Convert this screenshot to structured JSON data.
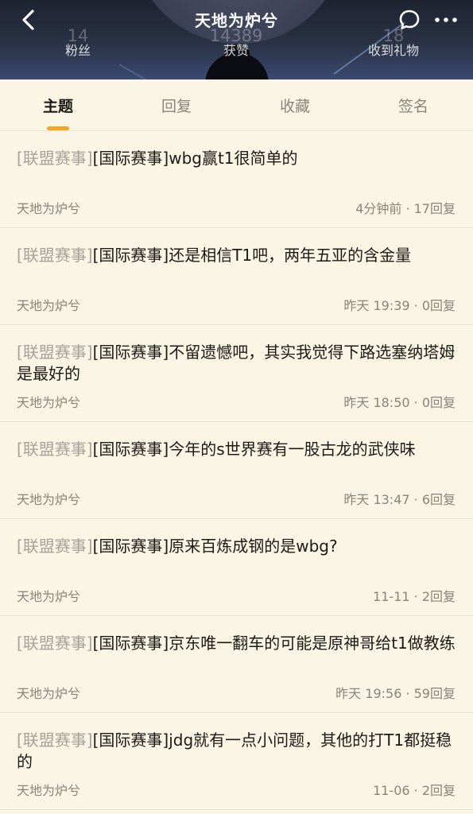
{
  "header": {
    "title": "天地为炉兮",
    "stats": [
      {
        "value": "14",
        "label": "粉丝"
      },
      {
        "value": "14389",
        "label": "获赞"
      },
      {
        "value": "18",
        "label": "收到礼物"
      }
    ]
  },
  "tabs": [
    {
      "label": "主题",
      "active": true
    },
    {
      "label": "回复",
      "active": false
    },
    {
      "label": "收藏",
      "active": false
    },
    {
      "label": "签名",
      "active": false
    }
  ],
  "posts": [
    {
      "tag": "[联盟赛事]",
      "title": "[国际赛事]wbg赢t1很简单的",
      "author": "天地为炉兮",
      "meta": "4分钟前 · 17回复"
    },
    {
      "tag": "[联盟赛事]",
      "title": "[国际赛事]还是相信T1吧，两年五亚的含金量",
      "author": "天地为炉兮",
      "meta": "昨天 19:39 · 0回复"
    },
    {
      "tag": "[联盟赛事]",
      "title": "[国际赛事]不留遗憾吧，其实我觉得下路选塞纳塔姆是最好的",
      "author": "天地为炉兮",
      "meta": "昨天 18:50 · 0回复"
    },
    {
      "tag": "[联盟赛事]",
      "title": "[国际赛事]今年的s世界赛有一股古龙的武侠味",
      "author": "天地为炉兮",
      "meta": "昨天 13:47 · 6回复"
    },
    {
      "tag": "[联盟赛事]",
      "title": "[国际赛事]原来百炼成钢的是wbg?",
      "author": "天地为炉兮",
      "meta": "11-11 · 2回复"
    },
    {
      "tag": "[联盟赛事]",
      "title": "[国际赛事]京东唯一翻车的可能是原神哥给t1做教练",
      "author": "天地为炉兮",
      "meta": "昨天 19:56 · 59回复"
    },
    {
      "tag": "[联盟赛事]",
      "title": "[国际赛事]jdg就有一点小问题，其他的打T1都挺稳的",
      "author": "天地为炉兮",
      "meta": "11-06 · 2回复"
    }
  ],
  "colors": {
    "background": "#fbf5e5",
    "accent": "#f5a623",
    "tag": "#a8a29a",
    "meta": "#8a847a"
  },
  "icons": {
    "back": "chevron-left-icon",
    "message": "chat-bubble-icon",
    "more": "more-dots-icon"
  }
}
